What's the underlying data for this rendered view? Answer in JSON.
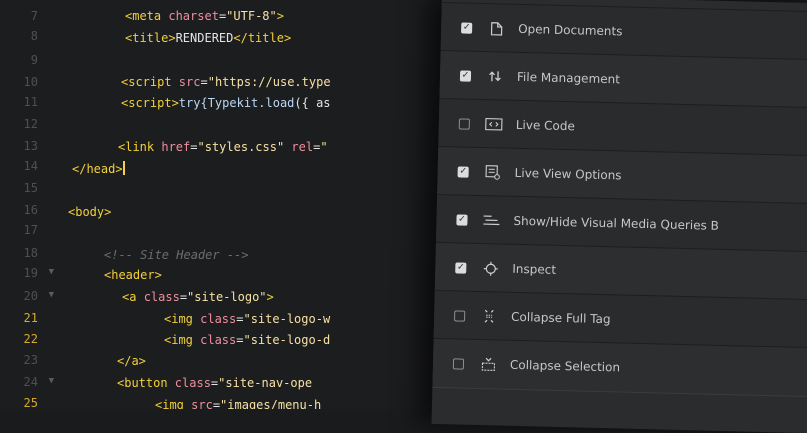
{
  "editor": {
    "lines": [
      {
        "num": "7",
        "fold": false,
        "active": false
      },
      {
        "num": "8",
        "fold": false,
        "active": false
      },
      {
        "num": "9",
        "fold": false,
        "active": false
      },
      {
        "num": "10",
        "fold": false,
        "active": false
      },
      {
        "num": "11",
        "fold": false,
        "active": false
      },
      {
        "num": "12",
        "fold": false,
        "active": false
      },
      {
        "num": "13",
        "fold": false,
        "active": false
      },
      {
        "num": "14",
        "fold": false,
        "active": false
      },
      {
        "num": "15",
        "fold": false,
        "active": false
      },
      {
        "num": "16",
        "fold": false,
        "active": false
      },
      {
        "num": "17",
        "fold": false,
        "active": false
      },
      {
        "num": "18",
        "fold": false,
        "active": false
      },
      {
        "num": "19",
        "fold": true,
        "active": false
      },
      {
        "num": "20",
        "fold": true,
        "active": false
      },
      {
        "num": "21",
        "fold": false,
        "active": true
      },
      {
        "num": "22",
        "fold": false,
        "active": true
      },
      {
        "num": "23",
        "fold": false,
        "active": false
      },
      {
        "num": "24",
        "fold": true,
        "active": false
      },
      {
        "num": "25",
        "fold": false,
        "active": true
      }
    ],
    "code": {
      "l7": {
        "open": "<meta ",
        "attr": "charset",
        "eq": "=",
        "str": "\"UTF-8\"",
        "close": ">"
      },
      "l8": {
        "open": "<title>",
        "text": "RENDERED",
        "close": "</title>"
      },
      "l10": {
        "open": "<script ",
        "attr": "src",
        "eq": "=",
        "str": "\"https://use.type"
      },
      "l11": {
        "open": "<script>",
        "fn": "try{Typekit.",
        "fn2": "load",
        "text": "({ as"
      },
      "l13": {
        "open": "<link ",
        "attr": "href",
        "eq": "=",
        "str": "\"styles.css\"",
        "attr2": " rel",
        "eq2": "=",
        "str2": "\""
      },
      "l14": {
        "open": "</head>"
      },
      "l16": {
        "open": "<body>"
      },
      "l18": {
        "comment": "<!-- Site Header -->"
      },
      "l19": {
        "open": "<header>"
      },
      "l20": {
        "open": "<a ",
        "attr": "class",
        "eq": "=",
        "str": "\"site-logo\"",
        "close": ">"
      },
      "l21": {
        "open": "<img ",
        "attr": "class",
        "eq": "=",
        "str": "\"site-logo-w"
      },
      "l22": {
        "open": "<img ",
        "attr": "class",
        "eq": "=",
        "str": "\"site-logo-d"
      },
      "l23": {
        "open": "</a>"
      },
      "l24": {
        "open": "<button ",
        "attr": "class",
        "eq": "=",
        "str": "\"site-nav-ope"
      },
      "l25": {
        "open": "<img ",
        "attr": "src",
        "eq": "=",
        "str": "\"images/menu-h"
      }
    }
  },
  "menu": {
    "items": [
      {
        "label": "Open Documents",
        "checked": true,
        "icon": "document-icon"
      },
      {
        "label": "File Management",
        "checked": true,
        "icon": "up-down-arrows-icon"
      },
      {
        "label": "Live Code",
        "checked": false,
        "icon": "code-box-icon"
      },
      {
        "label": "Live View Options",
        "checked": true,
        "icon": "view-options-icon"
      },
      {
        "label": "Show/Hide Visual Media Queries B",
        "checked": true,
        "icon": "media-queries-icon"
      },
      {
        "label": "Inspect",
        "checked": true,
        "icon": "crosshair-icon"
      },
      {
        "label": "Collapse Full Tag",
        "checked": false,
        "icon": "collapse-tag-icon"
      },
      {
        "label": "Collapse Selection",
        "checked": false,
        "icon": "collapse-selection-icon"
      }
    ]
  },
  "colors": {
    "editor_bg": "#1c1d1f",
    "panel_bg": "#2b2c2e",
    "tag": "#f2d03a",
    "attr": "#ee8f9c",
    "string": "#f6e0a4",
    "comment": "#6a6d71",
    "active_line_number": "#d6a92a"
  }
}
